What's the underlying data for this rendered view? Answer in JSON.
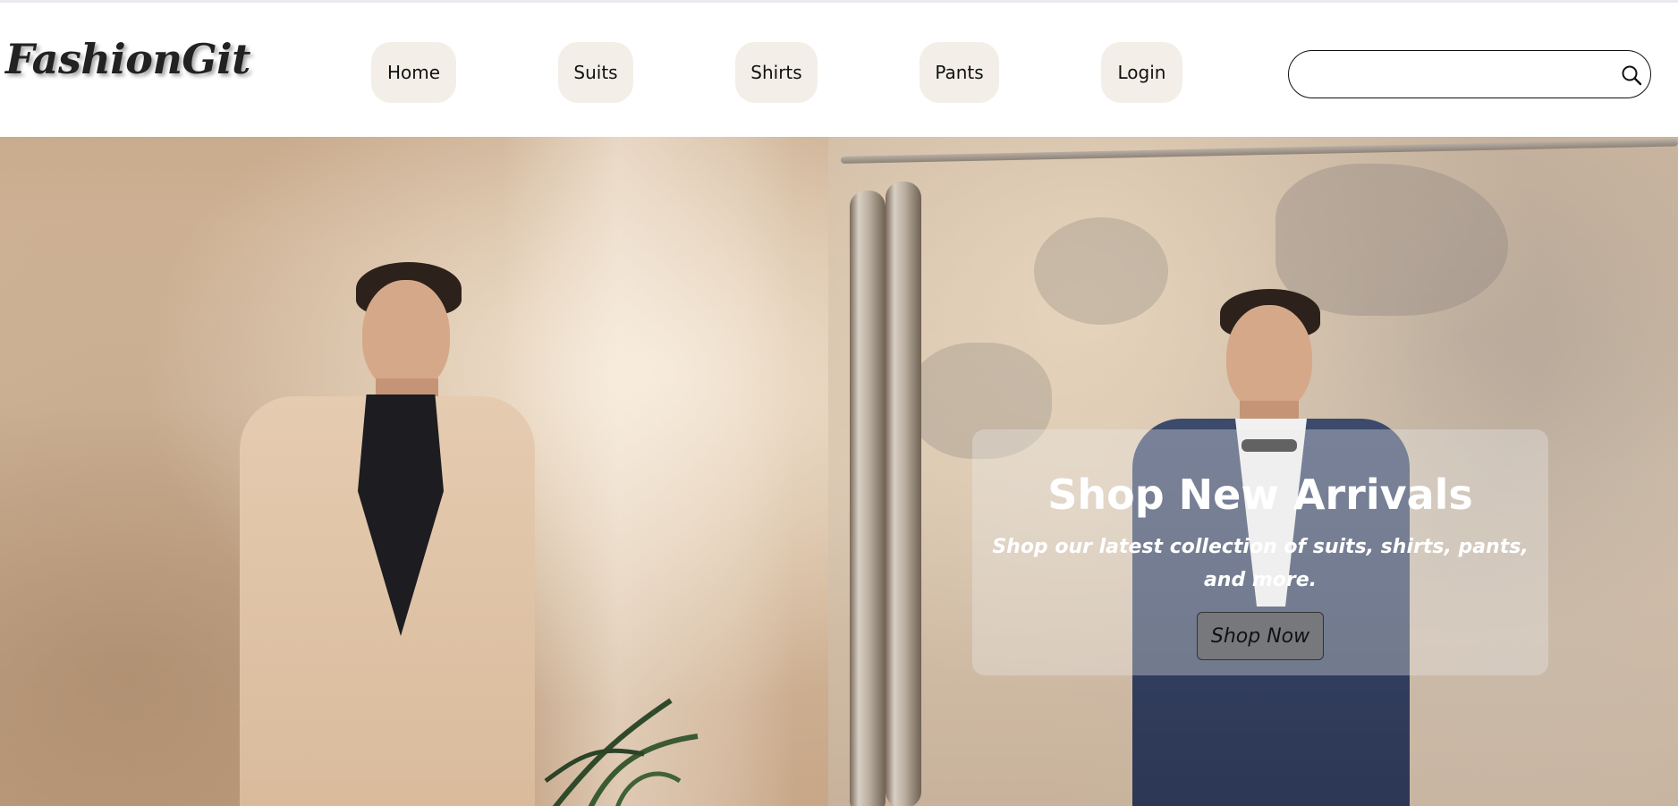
{
  "header": {
    "logo_text": "FashionGit",
    "nav": [
      {
        "label": "Home"
      },
      {
        "label": "Suits"
      },
      {
        "label": "Shirts"
      },
      {
        "label": "Pants"
      },
      {
        "label": "Login"
      }
    ],
    "search": {
      "value": "",
      "placeholder": "",
      "icon": "search-icon"
    }
  },
  "hero": {
    "title": "Shop New Arrivals",
    "subtitle": "Shop our latest collection of suits, shirts, pants, and more.",
    "cta_label": "Shop Now",
    "colors": {
      "nav_button_bg": "#f3efe8",
      "overlay_text": "#ffffff",
      "cta_bg": "#7a7a7a"
    }
  }
}
